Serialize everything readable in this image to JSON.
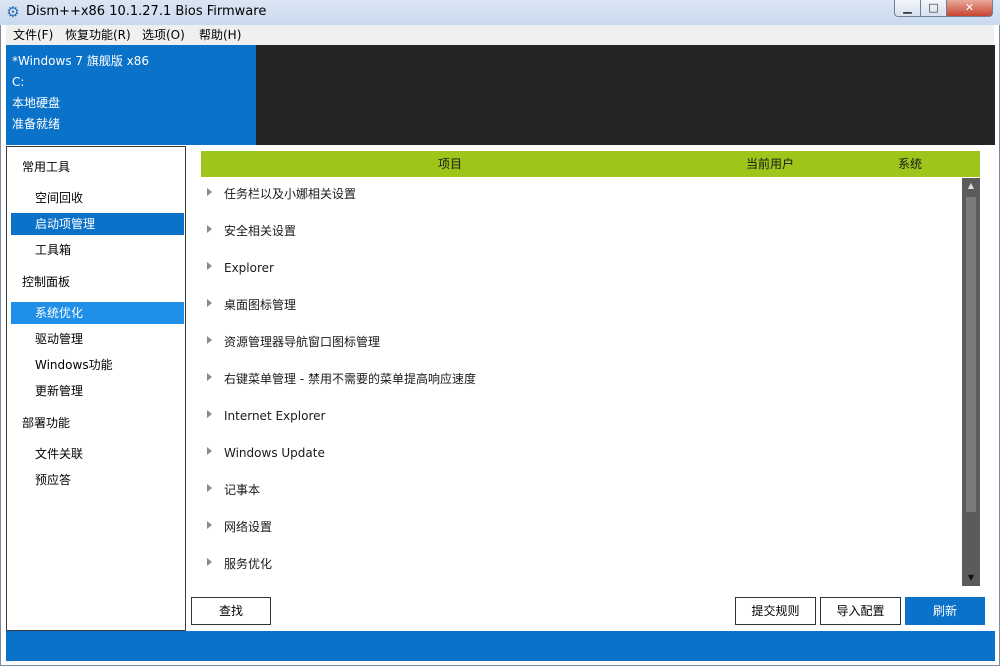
{
  "window": {
    "title": "Dism++x86 10.1.27.1 Bios Firmware",
    "min_glyph": "▁",
    "max_glyph": "□",
    "close_glyph": "✕"
  },
  "menu": [
    "文件(F)",
    "恢复功能(R)",
    "选项(O)",
    "帮助(H)"
  ],
  "header": {
    "os": "*Windows 7 旗舰版 x86",
    "drive": "C:",
    "disk": "本地硬盘",
    "status": "准备就绪"
  },
  "sidebar": {
    "groups": [
      {
        "label": "常用工具",
        "items": [
          "空间回收",
          "启动项管理",
          "工具箱"
        ]
      },
      {
        "label": "控制面板",
        "items": [
          "系统优化",
          "驱动管理",
          "Windows功能",
          "更新管理"
        ]
      },
      {
        "label": "部署功能",
        "items": [
          "文件关联",
          "预应答"
        ]
      }
    ],
    "selected": "启动项管理",
    "active": "系统优化"
  },
  "table": {
    "columns": [
      "项目",
      "当前用户",
      "系统"
    ],
    "rows": [
      "任务栏以及小娜相关设置",
      "安全相关设置",
      "Explorer",
      "桌面图标管理",
      "资源管理器导航窗口图标管理",
      "右键菜单管理 - 禁用不需要的菜单提高响应速度",
      "Internet Explorer",
      "Windows Update",
      "记事本",
      "网络设置",
      "服务优化"
    ]
  },
  "buttons": {
    "find": "查找",
    "submit_rules": "提交规则",
    "import_config": "导入配置",
    "refresh": "刷新"
  },
  "colors": {
    "accent": "#0a72c9",
    "table_header": "#9dc51a",
    "header_dark": "#252525"
  },
  "icons": {
    "app": "gear-icon",
    "row_expand": "triangle-right-icon",
    "scroll_up": "arrow-up-icon",
    "scroll_down": "arrow-down-icon"
  }
}
